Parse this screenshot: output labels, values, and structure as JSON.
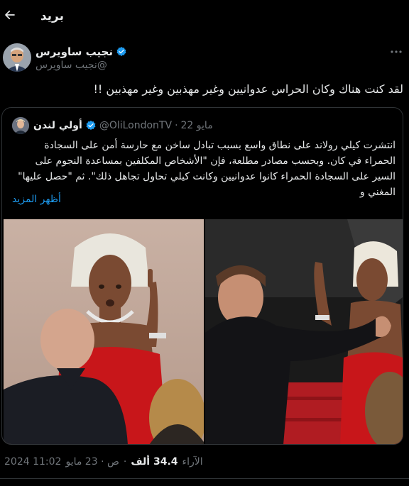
{
  "header": {
    "title": "بريد",
    "back_icon": "back-arrow-icon"
  },
  "author": {
    "name": "نجيب ساويرس",
    "handle": "@نجيب ساويرس",
    "verified": true
  },
  "tweet": {
    "text": "لقد كنت هناك وكان الحراس عدوانيين وغير مهذبين وغير مهذبين !!"
  },
  "quote": {
    "name": "أولي لندن",
    "handle": "@OliLondonTV",
    "date": "مايو 22",
    "lines": [
      "انتشرت كيلي رولاند على نطاق واسع بسبب تبادل ساخن مع حارسة أمن على السجادة",
      "الحمراء في كان. وبحسب مصادر مطلعة، فإن \"الأشخاص المكلفين بمساعدة النجوم على",
      "السير على السجادة الحمراء كانوا عدوانيين وكانت كيلي تحاول تجاهل ذلك\". ثم \"حصل عليها\"",
      "المغني و"
    ],
    "show_more": "أظهر المزيد"
  },
  "meta": {
    "time": "11:02 2024",
    "date": "ص · 23 مايو",
    "views_count": "34.4 ألف",
    "views_label": "الآراء"
  },
  "colors": {
    "background": "#000000",
    "text": "#e7e9ea",
    "muted": "#71767b",
    "accent": "#1d9bf0",
    "border": "#2f3336"
  }
}
